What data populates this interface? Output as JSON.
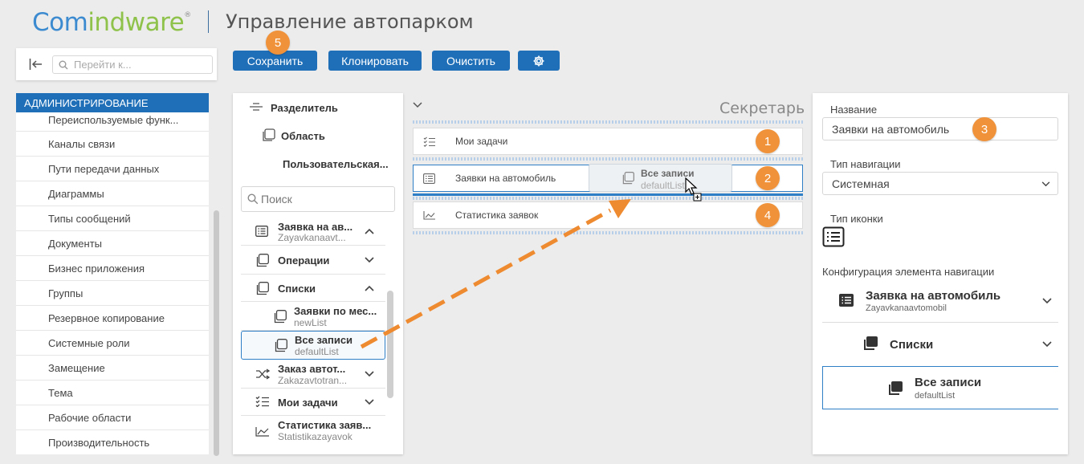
{
  "header": {
    "logo_part1": "Com",
    "logo_part2": "indware",
    "logo_reg": "®",
    "title": "Управление автопарком"
  },
  "toolbar": {
    "save_label": "Сохранить",
    "clone_label": "Клонировать",
    "clear_label": "Очистить",
    "settings_icon": "gear-icon"
  },
  "badges": [
    "1",
    "2",
    "3",
    "4",
    "5"
  ],
  "nav": {
    "search_placeholder": "Перейти к...",
    "section_title": "АДМИНИСТРИРОВАНИЕ",
    "items": [
      "Переиспользуемые функ...",
      "Каналы связи",
      "Пути передачи данных",
      "Диаграммы",
      "Типы сообщений",
      "Документы",
      "Бизнес приложения",
      "Группы",
      "Резервное копирование",
      "Системные роли",
      "Замещение",
      "Тема",
      "Рабочие области",
      "Производительность"
    ]
  },
  "toolbox": {
    "separator_label": "Разделитель",
    "area_label": "Область",
    "custom_label": "Пользовательская...",
    "search_placeholder": "Поиск",
    "tree": [
      {
        "title": "Заявка на ав...",
        "subtitle": "Zayavkanaavt..."
      },
      {
        "title": "Операции"
      },
      {
        "title": "Списки"
      },
      {
        "title": "Заявки по мес...",
        "subtitle": "newList"
      },
      {
        "title": "Все записи",
        "subtitle": "defaultList"
      },
      {
        "title": "Заказ автот...",
        "subtitle": "Zakazavtotran..."
      },
      {
        "title": "Мои задачи"
      },
      {
        "title": "Статистика заяв...",
        "subtitle": "Statistikazayavok"
      }
    ]
  },
  "workspace": {
    "group_title": "Секретарь",
    "rows": [
      "Мои задачи",
      "Заявки на автомобиль",
      "Статистика заявок"
    ],
    "drag_ghost": {
      "title": "Все записи",
      "subtitle": "defaultList"
    }
  },
  "properties": {
    "name_label": "Название",
    "name_value": "Заявки на автомобиль",
    "nav_type_label": "Тип навигации",
    "nav_type_value": "Системная",
    "icon_type_label": "Тип иконки",
    "config_label": "Конфигурация элемента навигации",
    "config_item": {
      "title": "Заявка на автомобиль",
      "subtitle": "Zayavkanaavtomobil"
    },
    "config_lists": "Списки",
    "config_selected": {
      "title": "Все записи",
      "subtitle": "defaultList"
    }
  },
  "colors": {
    "accent": "#1f6fb8",
    "badge": "#f0923a",
    "logo_blue": "#3c8bd0",
    "logo_green": "#8ec24a"
  }
}
